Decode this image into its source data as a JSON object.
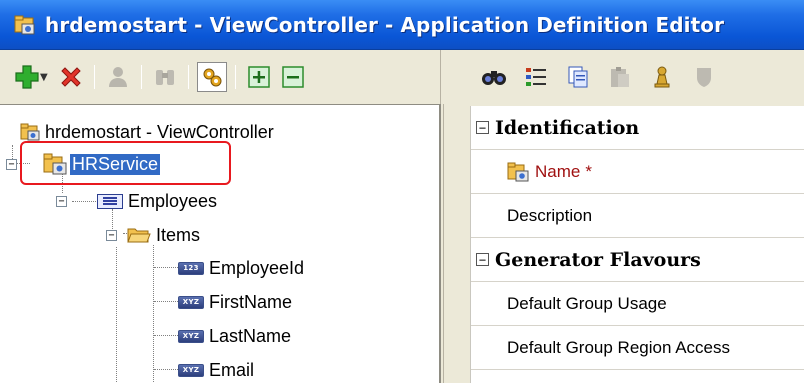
{
  "window": {
    "title": "hrdemostart - ViewController - Application Definition Editor"
  },
  "toolbar_left": {
    "buttons": [
      {
        "icon": "add-icon"
      },
      {
        "icon": "delete-icon"
      },
      {
        "icon": "user-icon"
      },
      {
        "icon": "binoculars-disabled-icon"
      },
      {
        "icon": "gears-icon"
      },
      {
        "icon": "expand-all-icon"
      },
      {
        "icon": "collapse-all-icon"
      }
    ]
  },
  "toolbar_right": {
    "buttons": [
      {
        "icon": "find-icon"
      },
      {
        "icon": "list-icon"
      },
      {
        "icon": "copy-icon"
      },
      {
        "icon": "paste-icon"
      },
      {
        "icon": "chess-pawn-icon"
      },
      {
        "icon": "shield-icon"
      }
    ]
  },
  "tree": {
    "root": "hrdemostart - ViewController",
    "service": "HRService",
    "entity": "Employees",
    "folder": "Items",
    "attributes": [
      {
        "badge": "123",
        "label": "EmployeeId"
      },
      {
        "badge": "XYZ",
        "label": "FirstName"
      },
      {
        "badge": "XYZ",
        "label": "LastName"
      },
      {
        "badge": "XYZ",
        "label": "Email"
      }
    ]
  },
  "properties": {
    "sections": [
      {
        "header": "Identification",
        "rows": [
          "Name",
          "Description"
        ],
        "required_marker": "*"
      },
      {
        "header": "Generator Flavours",
        "rows": [
          "Default Group Usage",
          "Default Group Region Access"
        ]
      }
    ]
  },
  "colors": {
    "titlebar": "#0a56d6",
    "selection": "#316ac5",
    "highlight": "#e8191f"
  }
}
